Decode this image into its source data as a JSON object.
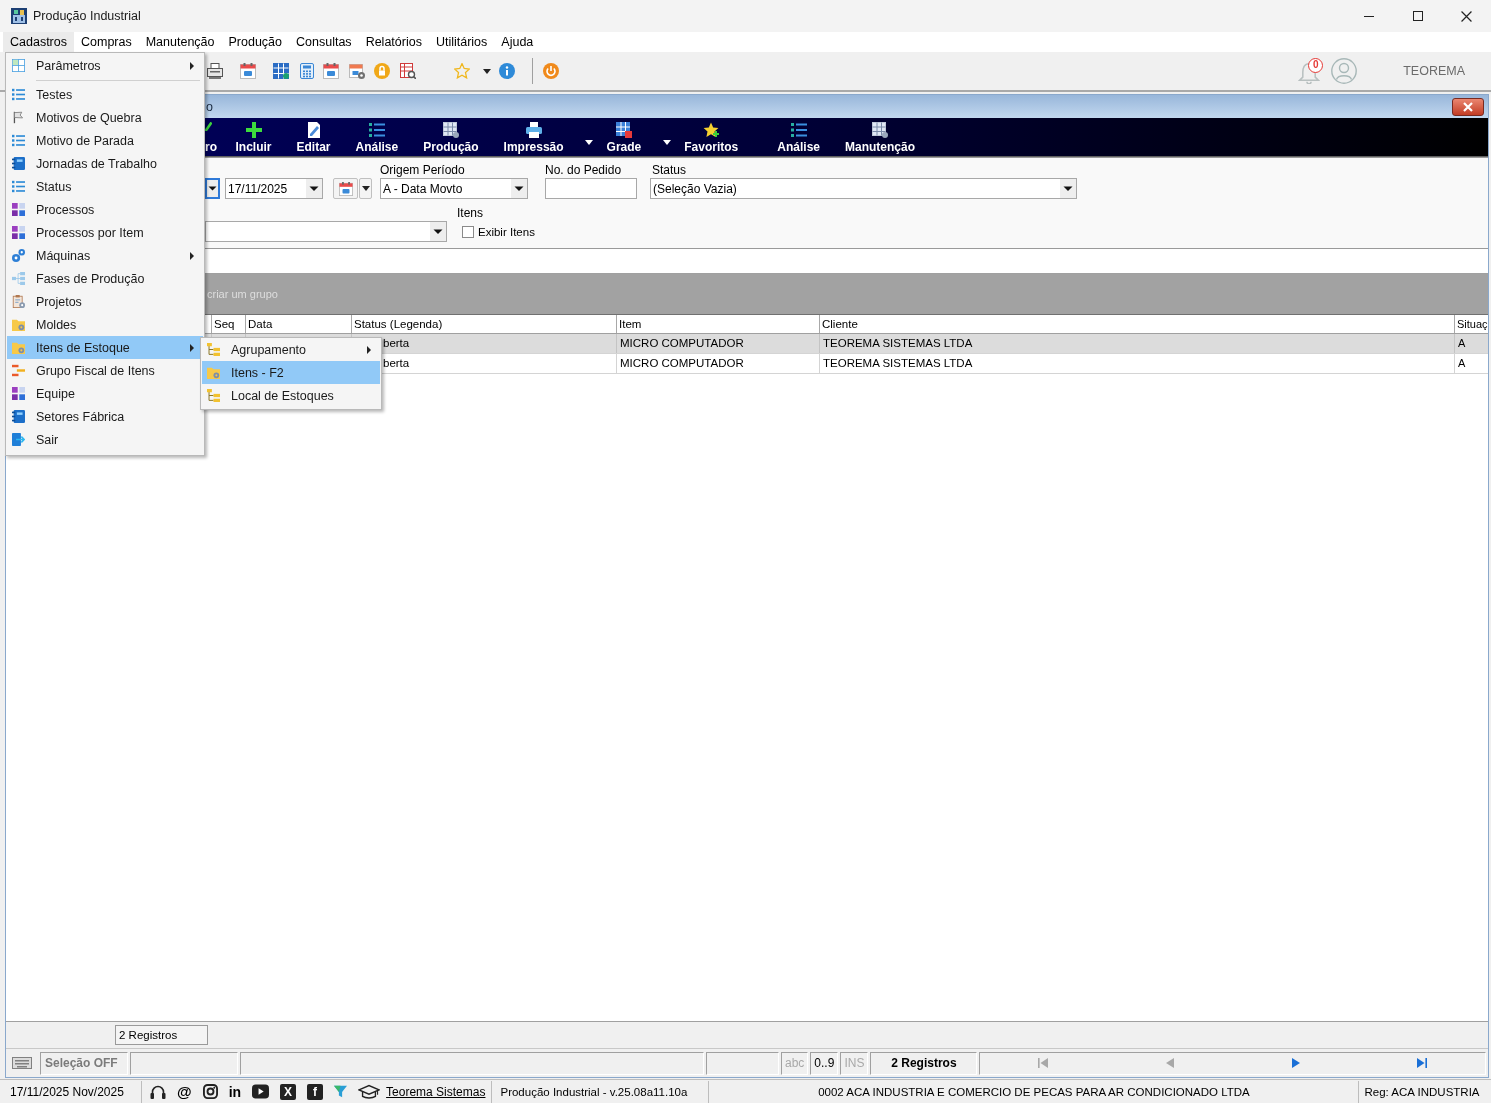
{
  "window": {
    "title": "Produção Industrial"
  },
  "menubar": [
    {
      "label": "Cadastros",
      "selected": true
    },
    {
      "label": "Compras",
      "selected": false
    },
    {
      "label": "Manutenção",
      "selected": false
    },
    {
      "label": "Produção",
      "selected": false
    },
    {
      "label": "Consultas",
      "selected": false
    },
    {
      "label": "Relatórios",
      "selected": false
    },
    {
      "label": "Utilitários",
      "selected": false
    },
    {
      "label": "Ajuda",
      "selected": false
    }
  ],
  "menu": {
    "groups": [
      {
        "items": [
          {
            "label": "Parâmetros",
            "has_submenu": true,
            "selected": false
          }
        ]
      },
      {
        "items": [
          {
            "label": "Testes",
            "has_submenu": false,
            "selected": false
          },
          {
            "label": "Motivos de Quebra",
            "has_submenu": false,
            "selected": false
          },
          {
            "label": "Motivo de Parada",
            "has_submenu": false,
            "selected": false
          },
          {
            "label": "Jornadas de Trabalho",
            "has_submenu": false,
            "selected": false
          },
          {
            "label": "Status",
            "has_submenu": false,
            "selected": false
          },
          {
            "label": "Processos",
            "has_submenu": false,
            "selected": false
          },
          {
            "label": "Processos por Item",
            "has_submenu": false,
            "selected": false
          },
          {
            "label": "Máquinas",
            "has_submenu": true,
            "selected": false
          },
          {
            "label": "Fases de Produção",
            "has_submenu": false,
            "selected": false
          },
          {
            "label": "Projetos",
            "has_submenu": false,
            "selected": false
          },
          {
            "label": "Moldes",
            "has_submenu": false,
            "selected": false
          },
          {
            "label": "Itens de Estoque",
            "has_submenu": true,
            "selected": true
          },
          {
            "label": "Grupo Fiscal de Itens",
            "has_submenu": false,
            "selected": false
          },
          {
            "label": "Equipe",
            "has_submenu": false,
            "selected": false
          },
          {
            "label": "Setores Fábrica",
            "has_submenu": false,
            "selected": false
          },
          {
            "label": "Sair",
            "has_submenu": false,
            "selected": false
          }
        ]
      }
    ]
  },
  "submenu": {
    "items": [
      {
        "label": "Agrupamento",
        "has_submenu": true,
        "selected": false
      },
      {
        "label": "Itens - F2",
        "has_submenu": false,
        "selected": true
      },
      {
        "label": "Local de Estoques",
        "has_submenu": false,
        "selected": false
      }
    ]
  },
  "toolbar": {
    "notification_count": "0",
    "user_name": "TEOREMA"
  },
  "child_window": {
    "title": "o",
    "toolbar": [
      {
        "label": "ro",
        "has_dropdown": false
      },
      {
        "label": "Incluir",
        "has_dropdown": false
      },
      {
        "label": "Editar",
        "has_dropdown": false
      },
      {
        "label": "Análise",
        "has_dropdown": false
      },
      {
        "label": "Produção",
        "has_dropdown": false
      },
      {
        "label": "Impressão",
        "has_dropdown": true
      },
      {
        "label": "Grade",
        "has_dropdown": true
      },
      {
        "label": "Favoritos",
        "has_dropdown": false
      },
      {
        "label": "Análise",
        "has_dropdown": false
      },
      {
        "label": "Manutenção",
        "has_dropdown": false
      }
    ],
    "filters": {
      "partial_dropdown": {
        "focused": true
      },
      "date": {
        "value": "17/11/2025"
      },
      "origin": {
        "label": "Origem Período",
        "value": "A - Data Movto"
      },
      "order": {
        "label": "No. do Pedido"
      },
      "status": {
        "label": "Status",
        "value": "(Seleção Vazia)"
      },
      "items": {
        "label": "Itens",
        "checkbox": {
          "label": "Exibir Itens",
          "checked": false
        }
      }
    },
    "group_panel": {
      "hint": "criar um grupo"
    },
    "table": {
      "columns": [
        "Seq",
        "Data",
        "Status (Legenda)",
        "Item",
        "Cliente",
        "Situaç"
      ],
      "rows": [
        {
          "selected": true,
          "status": "berta",
          "item": "MICRO COMPUTADOR",
          "client": "TEOREMA SISTEMAS LTDA",
          "situation": "A"
        },
        {
          "selected": false,
          "status": "berta",
          "item": "MICRO COMPUTADOR",
          "client": "TEOREMA SISTEMAS LTDA",
          "situation": "A"
        }
      ]
    },
    "footer": {
      "count": "2 Registros"
    },
    "status_bar": {
      "selection": "Seleção OFF",
      "indicators": [
        {
          "label": "abc",
          "active": false
        },
        {
          "label": "0..9",
          "active": true
        },
        {
          "label": "INS",
          "active": false
        }
      ],
      "count": "2 Registros",
      "navigation": [
        {
          "kind": "first",
          "disabled": true
        },
        {
          "kind": "previous",
          "disabled": true
        },
        {
          "kind": "next",
          "disabled": false
        },
        {
          "kind": "last",
          "disabled": false
        }
      ]
    }
  },
  "info_bar": {
    "date": "17/11/2025 Nov/2025",
    "social": [
      {
        "kind": "headset"
      },
      {
        "kind": "at",
        "glyph": "@"
      },
      {
        "kind": "camera"
      },
      {
        "kind": "in",
        "glyph": "in"
      },
      {
        "kind": "play"
      },
      {
        "kind": "x",
        "glyph": "X"
      },
      {
        "kind": "f",
        "glyph": "f"
      },
      {
        "kind": "funnel"
      },
      {
        "kind": "cap"
      }
    ],
    "link": "Teorema Sistemas",
    "version": "Produção Industrial - v.25.08a11.10a",
    "company": "0002 ACA INDUSTRIA E COMERCIO DE PECAS PARA AR CONDICIONADO LTDA",
    "registration": "Reg: ACA INDUSTRIA"
  }
}
